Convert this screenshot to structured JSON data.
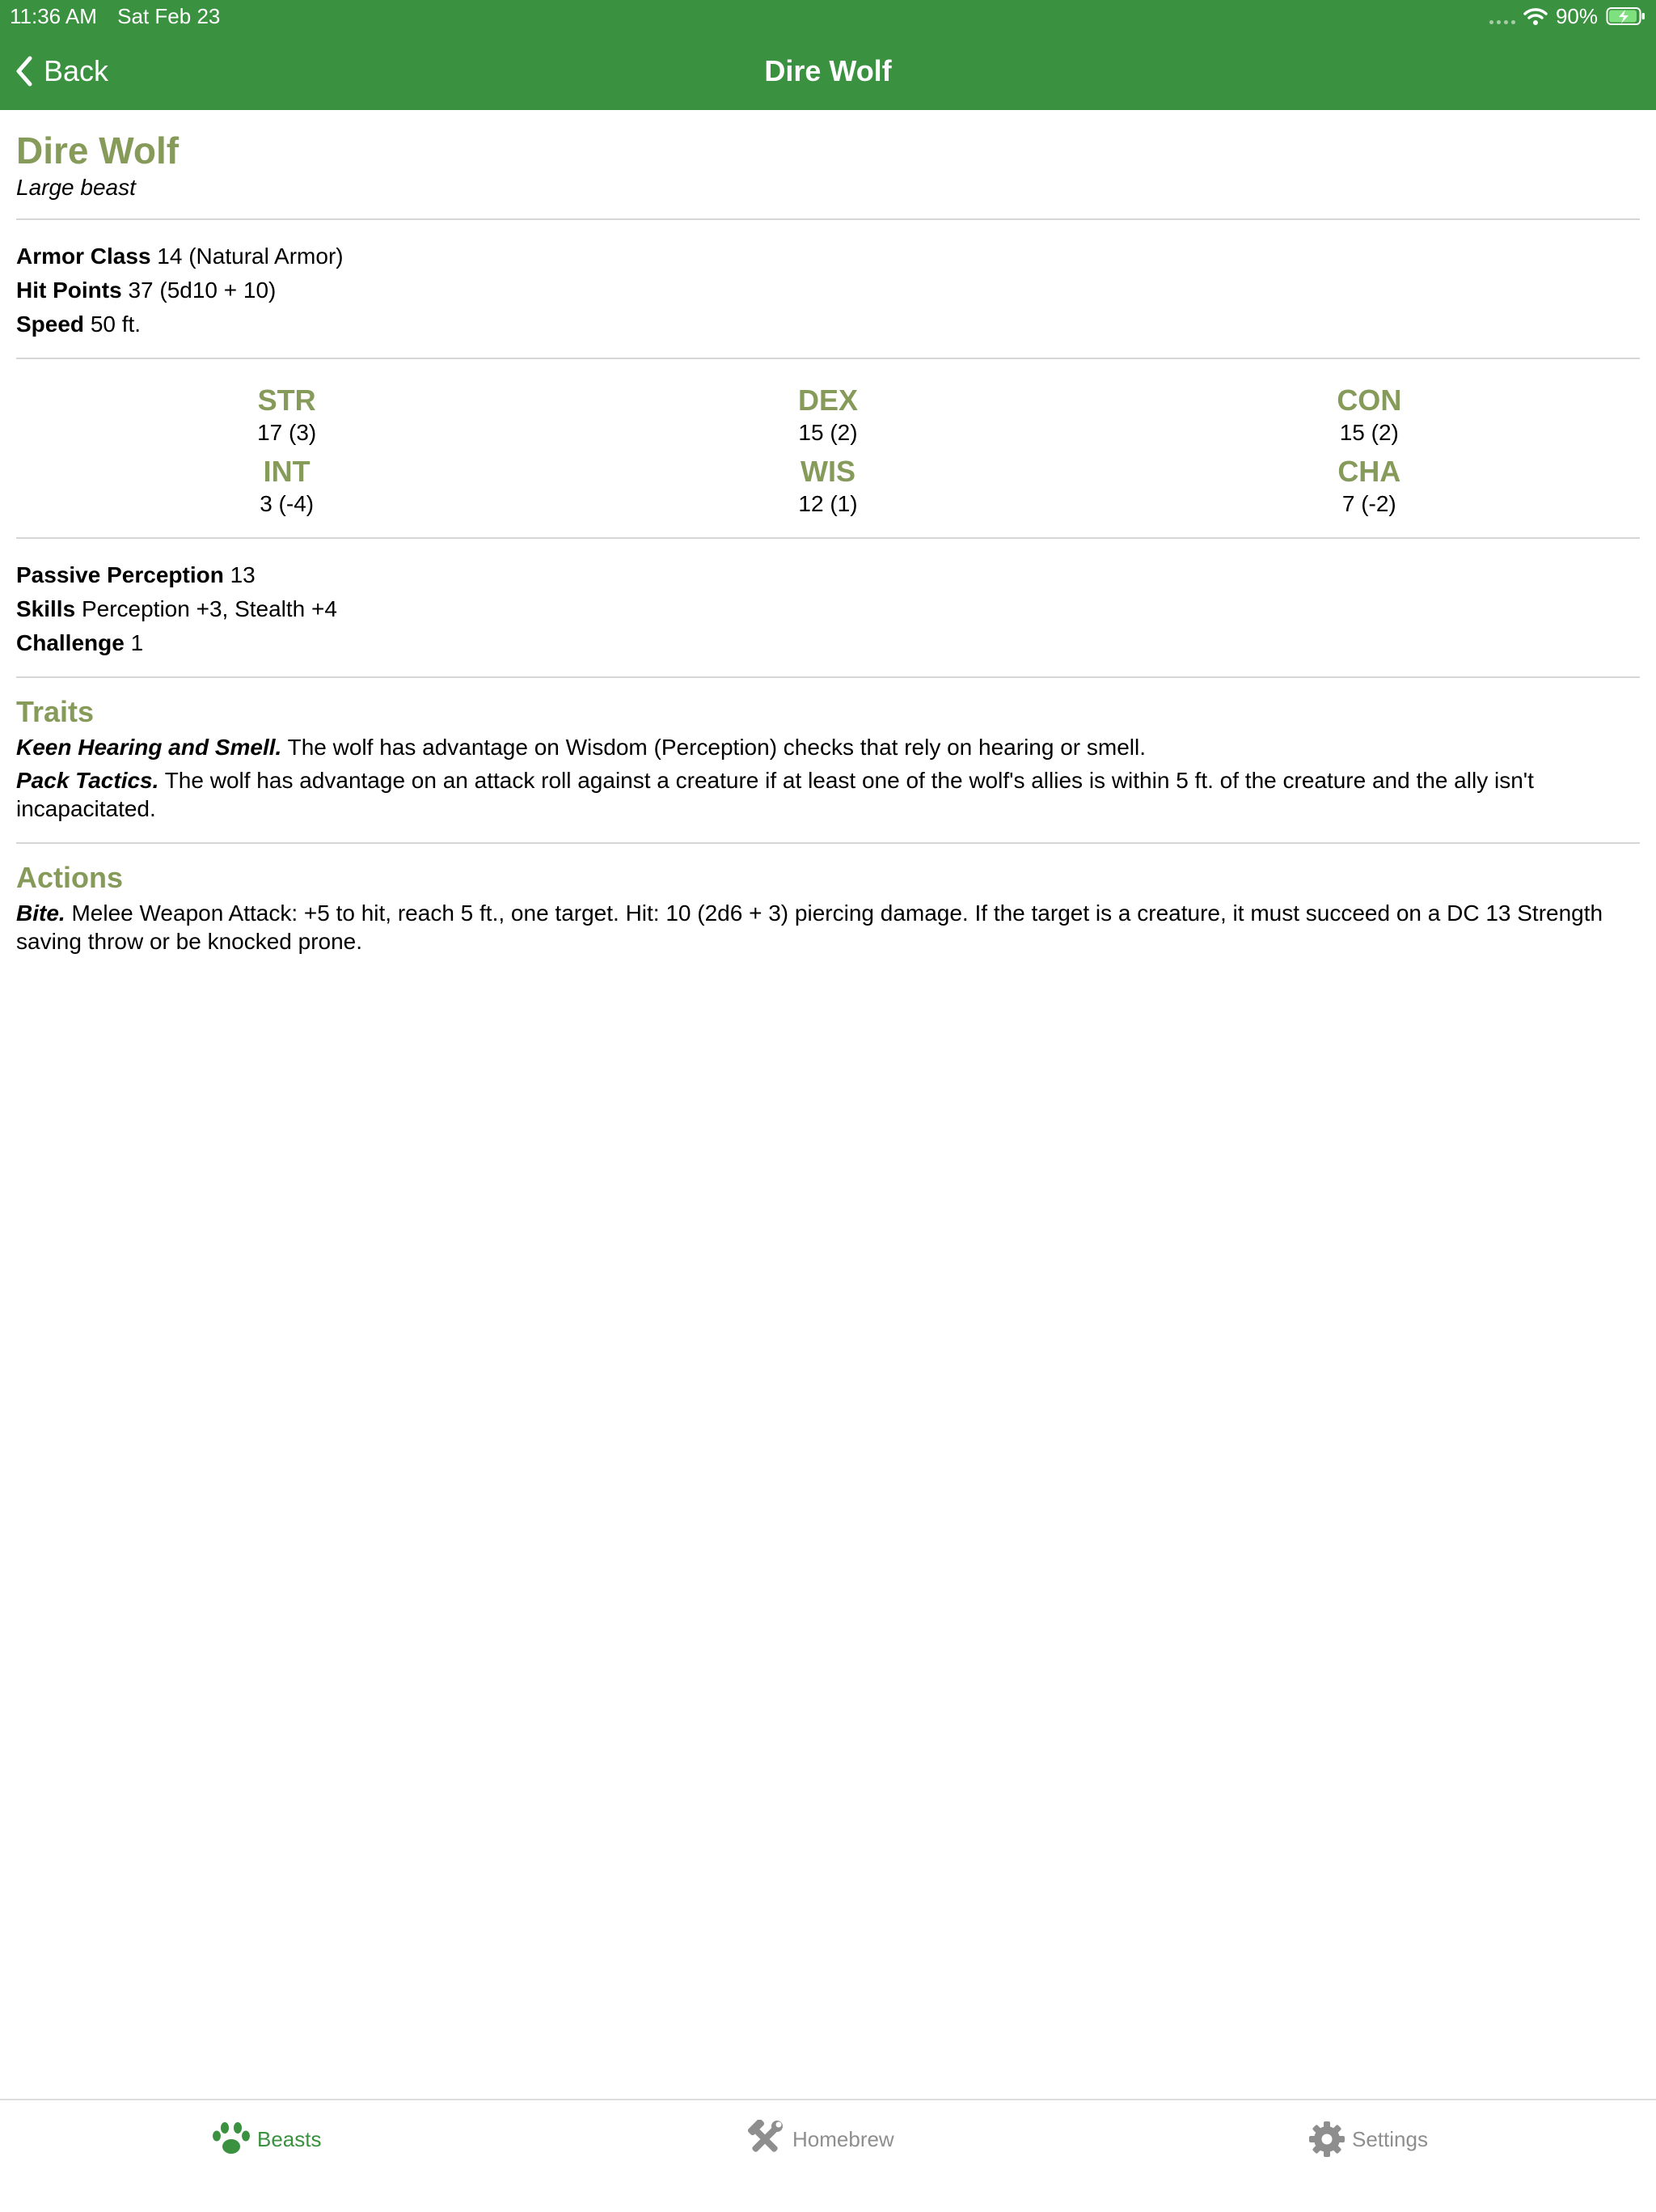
{
  "status": {
    "time": "11:36 AM",
    "date": "Sat Feb 23",
    "battery": "90%"
  },
  "nav": {
    "back_label": "Back",
    "title": "Dire Wolf"
  },
  "monster": {
    "name": "Dire Wolf",
    "type": "Large beast",
    "armor_class": {
      "label": "Armor Class",
      "value": "14 (Natural Armor)"
    },
    "hit_points": {
      "label": "Hit Points",
      "value": "37 (5d10 + 10)"
    },
    "speed": {
      "label": "Speed",
      "value": "50 ft."
    },
    "stats": [
      {
        "label": "STR",
        "value": "17 (3)"
      },
      {
        "label": "DEX",
        "value": "15 (2)"
      },
      {
        "label": "CON",
        "value": "15 (2)"
      },
      {
        "label": "INT",
        "value": "3 (-4)"
      },
      {
        "label": "WIS",
        "value": "12 (1)"
      },
      {
        "label": "CHA",
        "value": "7 (-2)"
      }
    ],
    "passive_perception": {
      "label": "Passive Perception",
      "value": "13"
    },
    "skills": {
      "label": "Skills",
      "value": "Perception +3, Stealth +4"
    },
    "challenge": {
      "label": "Challenge",
      "value": "1"
    },
    "traits": {
      "title": "Traits",
      "items": [
        {
          "name": "Keen Hearing and Smell.",
          "text": "The wolf has advantage on Wisdom (Perception) checks that rely on hearing or smell."
        },
        {
          "name": "Pack Tactics.",
          "text": "The wolf has advantage on an attack roll against a creature if at least one of the wolf's allies is within 5 ft. of the creature and the ally isn't incapacitated."
        }
      ]
    },
    "actions": {
      "title": "Actions",
      "items": [
        {
          "name": "Bite.",
          "text": "Melee Weapon Attack: +5 to hit, reach 5 ft., one target. Hit: 10 (2d6 + 3) piercing damage. If the target is a creature, it must succeed on a DC 13 Strength saving throw or be knocked prone."
        }
      ]
    }
  },
  "tabs": [
    {
      "label": "Beasts",
      "icon": "paw-icon",
      "active": true
    },
    {
      "label": "Homebrew",
      "icon": "tools-icon",
      "active": false
    },
    {
      "label": "Settings",
      "icon": "gear-icon",
      "active": false
    }
  ],
  "colors": {
    "header": "#3a913f",
    "accent": "#869a5a",
    "inactive_tab": "#8e8e8e"
  }
}
